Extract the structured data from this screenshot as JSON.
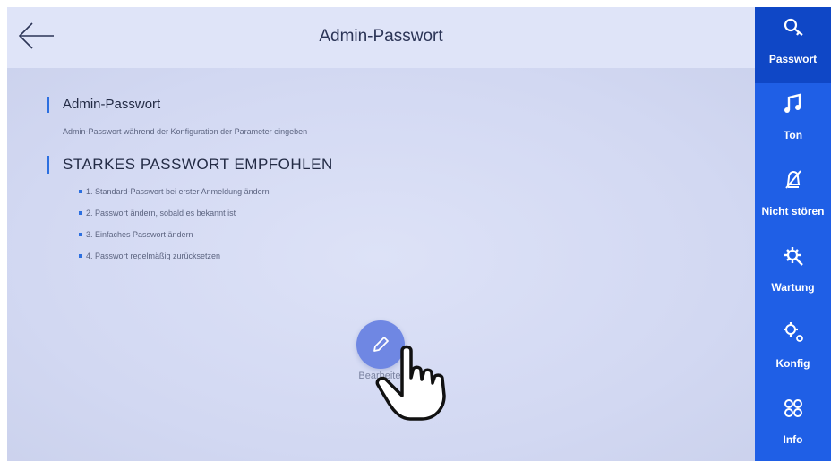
{
  "header": {
    "title": "Admin-Passwort",
    "back_icon": "back-arrow-icon"
  },
  "main": {
    "section1_title": "Admin-Passwort",
    "section1_desc": "Admin-Passwort während der Konfiguration der Parameter eingeben",
    "section2_title": "STARKES PASSWORT EMPFOHLEN",
    "recommendations": [
      "1. Standard-Passwort bei erster Anmeldung ändern",
      "2. Passwort ändern, sobald es bekannt ist",
      "3. Einfaches Passwort ändern",
      "4. Passwort regelmäßig zurücksetzen"
    ],
    "edit_label": "Bearbeiten",
    "edit_icon": "pencil-icon"
  },
  "sidebar": {
    "active_index": 0,
    "items": [
      {
        "label": "Passwort",
        "icon": "key-icon"
      },
      {
        "label": "Ton",
        "icon": "music-note-icon"
      },
      {
        "label": "Nicht stören",
        "icon": "bell-off-icon"
      },
      {
        "label": "Wartung",
        "icon": "maintenance-gear-icon"
      },
      {
        "label": "Konfig",
        "icon": "gears-icon"
      },
      {
        "label": "Info",
        "icon": "info-grid-icon"
      }
    ]
  },
  "colors": {
    "accent": "#1f5fe6",
    "accent_active": "#0f47c6",
    "edit_button": "#6f87e3",
    "background": "#d2d8f2"
  }
}
